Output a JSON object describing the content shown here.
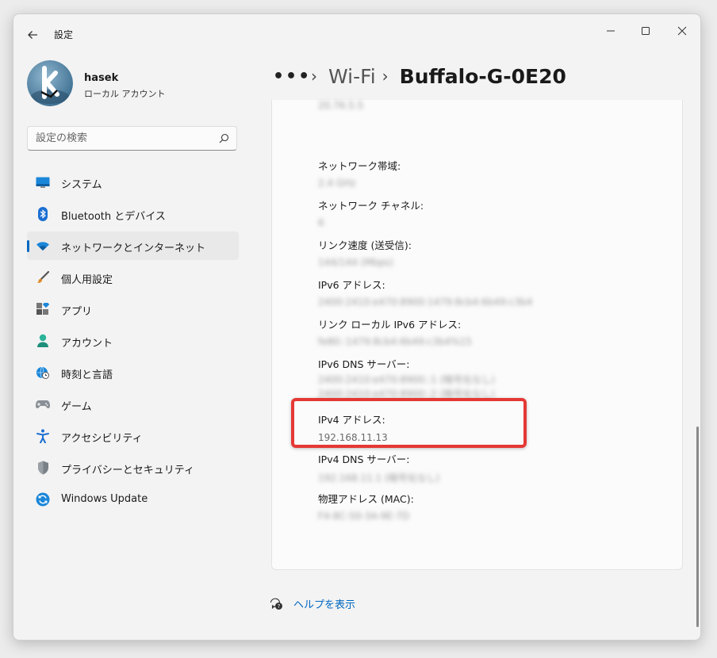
{
  "app": {
    "title": "設定"
  },
  "user": {
    "name": "hasek",
    "account_type": "ローカル アカウント"
  },
  "search": {
    "placeholder": "設定の検索"
  },
  "nav": {
    "items": [
      {
        "label": "システム",
        "icon": "monitor-icon"
      },
      {
        "label": "Bluetooth とデバイス",
        "icon": "bluetooth-icon"
      },
      {
        "label": "ネットワークとインターネット",
        "icon": "wifi-icon",
        "active": true
      },
      {
        "label": "個人用設定",
        "icon": "brush-icon"
      },
      {
        "label": "アプリ",
        "icon": "apps-icon"
      },
      {
        "label": "アカウント",
        "icon": "person-icon"
      },
      {
        "label": "時刻と言語",
        "icon": "globe-clock-icon"
      },
      {
        "label": "ゲーム",
        "icon": "gamepad-icon"
      },
      {
        "label": "アクセシビリティ",
        "icon": "accessibility-icon"
      },
      {
        "label": "プライバシーとセキュリティ",
        "icon": "shield-icon"
      },
      {
        "label": "Windows Update",
        "icon": "update-icon"
      }
    ]
  },
  "breadcrumb": {
    "more": "•••",
    "parent": "Wi-Fi",
    "current": "Buffalo-G-0E20"
  },
  "properties": {
    "top_partial_value": "20.76.5.5",
    "items": [
      {
        "label": "ネットワーク帯域:",
        "value": "2.4 GHz",
        "blurred": true
      },
      {
        "label": "ネットワーク チャネル:",
        "value": "6",
        "blurred": true
      },
      {
        "label": "リンク速度 (送受信):",
        "value": "144/144 (Mbps)",
        "blurred": true
      },
      {
        "label": "IPv6 アドレス:",
        "value": "2400:2410:e470:8900:1479:8cb4:6b49:c3b4",
        "blurred": true
      },
      {
        "label": "リンク ローカル IPv6 アドレス:",
        "value": "fe80::1479:8cb4:6b49:c3b4%15",
        "blurred": true
      },
      {
        "label": "IPv6 DNS サーバー:",
        "value": "2400:2410:e470:8900::1 (暗号化なし)",
        "value2": "2400:2410:e470:8900::2 (暗号化なし)",
        "blurred": true
      },
      {
        "label": "IPv4 アドレス:",
        "value": "192.168.11.13",
        "blurred": false
      },
      {
        "label": "IPv4 DNS サーバー:",
        "value": "192.168.11.1 (暗号化なし)",
        "blurred": true
      },
      {
        "label": "物理アドレス (MAC):",
        "value": "F4-8C-50-3A-9E-7D",
        "blurred": true
      }
    ]
  },
  "help": {
    "label": "ヘルプを表示"
  },
  "colors": {
    "accent": "#0067c0",
    "highlight": "#e53935"
  }
}
